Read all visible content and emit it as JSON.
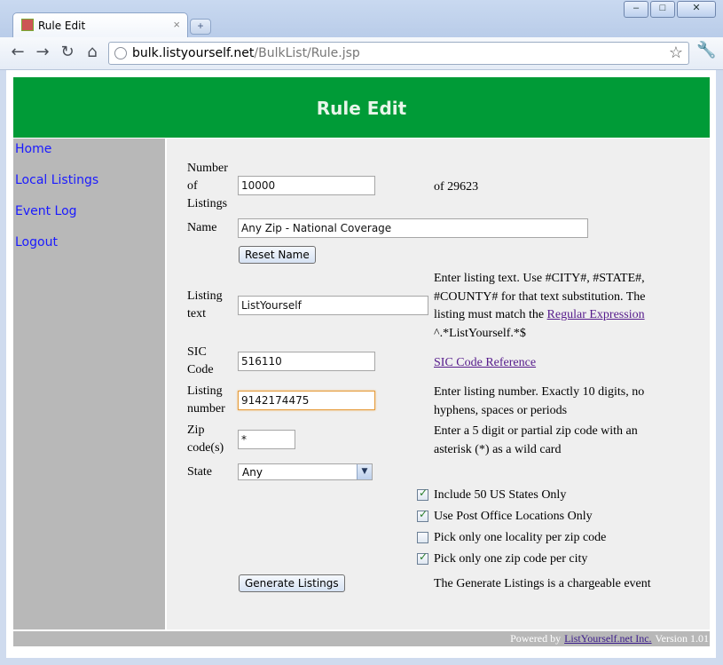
{
  "browser": {
    "tab_title": "Rule Edit",
    "tab_close": "×",
    "new_tab": "+",
    "url_host": "bulk.listyourself.net",
    "url_path": "/BulkList/Rule.jsp",
    "window_buttons": [
      "–",
      "□",
      "✕"
    ]
  },
  "header": {
    "title": "Rule Edit"
  },
  "sidebar": {
    "items": [
      {
        "label": "Home"
      },
      {
        "label": "Local Listings"
      },
      {
        "label": "Event Log"
      },
      {
        "label": "Logout"
      }
    ]
  },
  "form": {
    "listings": {
      "label_1": "Number",
      "label_2": "of",
      "label_3": "Listings",
      "value": "10000",
      "total": "of 29623"
    },
    "name": {
      "label": "Name",
      "value": "Any Zip - National Coverage",
      "reset_button": "Reset Name"
    },
    "listing_text": {
      "label_1": "Listing",
      "label_2": "text",
      "value": "ListYourself",
      "help_1": "Enter listing text. Use #CITY#, #STATE#,",
      "help_2": "#COUNTY# for that text substitution. The",
      "help_3": "listing must match the",
      "help_link": "Regular Expression",
      "help_4": "^.*ListYourself.*$"
    },
    "sic": {
      "label_1": "SIC",
      "label_2": "Code",
      "value": "516110",
      "reference_link": "SIC Code Reference"
    },
    "listing_number": {
      "label_1": "Listing",
      "label_2": "number",
      "value": "9142174475",
      "help_1": "Enter listing number. Exactly 10 digits, no",
      "help_2": "hyphens, spaces or periods"
    },
    "zip": {
      "label_1": "Zip",
      "label_2": "code(s)",
      "value": "*",
      "help_1": "Enter a 5 digit or partial zip code with an",
      "help_2": "asterisk (*) as a wild card"
    },
    "state": {
      "label": "State",
      "selected": "Any"
    },
    "checkboxes": [
      {
        "label": "Include 50 US States Only",
        "checked": true
      },
      {
        "label": "Use Post Office Locations Only",
        "checked": true
      },
      {
        "label": "Pick only one locality per zip code",
        "checked": false
      },
      {
        "label": "Pick only one zip code per city",
        "checked": true
      }
    ],
    "generate_button": "Generate Listings",
    "generate_note": "The Generate Listings is a chargeable event"
  },
  "footer": {
    "prefix": "Powered by",
    "company": "ListYourself.net Inc.",
    "version": "Version 1.01"
  }
}
